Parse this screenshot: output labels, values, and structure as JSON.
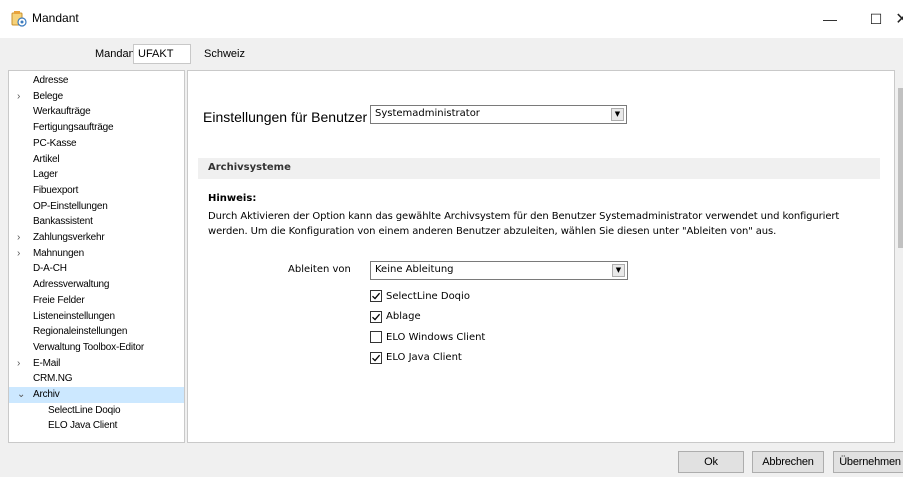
{
  "window": {
    "title": "Mandant",
    "minimize_glyph": "—",
    "maximize_glyph": "☐",
    "close_glyph": "✕"
  },
  "header": {
    "mandant_label": "Mandant",
    "mandant_value": "UFAKT",
    "mandant_description": "Schweiz"
  },
  "sidebar": {
    "items": [
      {
        "label": "Adresse",
        "expander": ""
      },
      {
        "label": "Belege",
        "expander": ">"
      },
      {
        "label": "Werkaufträge",
        "expander": ""
      },
      {
        "label": "Fertigungsaufträge",
        "expander": ""
      },
      {
        "label": "PC-Kasse",
        "expander": ""
      },
      {
        "label": "Artikel",
        "expander": ""
      },
      {
        "label": "Lager",
        "expander": ""
      },
      {
        "label": "Fibuexport",
        "expander": ""
      },
      {
        "label": "OP-Einstellungen",
        "expander": ""
      },
      {
        "label": "Bankassistent",
        "expander": ""
      },
      {
        "label": "Zahlungsverkehr",
        "expander": ">"
      },
      {
        "label": "Mahnungen",
        "expander": ">"
      },
      {
        "label": "D-A-CH",
        "expander": ""
      },
      {
        "label": "Adressverwaltung",
        "expander": ""
      },
      {
        "label": "Freie Felder",
        "expander": ""
      },
      {
        "label": "Listeneinstellungen",
        "expander": ""
      },
      {
        "label": "Regionaleinstellungen",
        "expander": ""
      },
      {
        "label": "Verwaltung Toolbox-Editor",
        "expander": ""
      },
      {
        "label": "E-Mail",
        "expander": ">"
      },
      {
        "label": "CRM.NG",
        "expander": ""
      },
      {
        "label": "Archiv",
        "expander": "v"
      },
      {
        "label": "SelectLine Doqio",
        "expander": ""
      },
      {
        "label": "ELO Java Client",
        "expander": ""
      }
    ]
  },
  "main": {
    "user_label": "Einstellungen für Benutzer",
    "user_value": "Systemadministrator",
    "section_title": "Archivsysteme",
    "hint_title": "Hinweis:",
    "hint_text": "Durch Aktivieren der Option kann das gewählte Archivsystem für den Benutzer Systemadministrator verwendet und konfiguriert werden. Um die Konfiguration von einem anderen Benutzer abzuleiten, wählen Sie diesen unter \"Ableiten von\" aus.",
    "derive_label": "Ableiten von",
    "derive_value": "Keine Ableitung",
    "checkboxes": [
      {
        "label": "SelectLine Doqio",
        "checked": true
      },
      {
        "label": "Ablage",
        "checked": true
      },
      {
        "label": "ELO Windows Client",
        "checked": false
      },
      {
        "label": "ELO Java Client",
        "checked": true
      }
    ]
  },
  "footer": {
    "ok_label": "Ok",
    "cancel_label": "Abbrechen",
    "apply_label": "Übernehmen"
  },
  "colors": {
    "selection": "#cce8ff",
    "background": "#f0f0f0",
    "icon_accent": "#e8a33c"
  }
}
